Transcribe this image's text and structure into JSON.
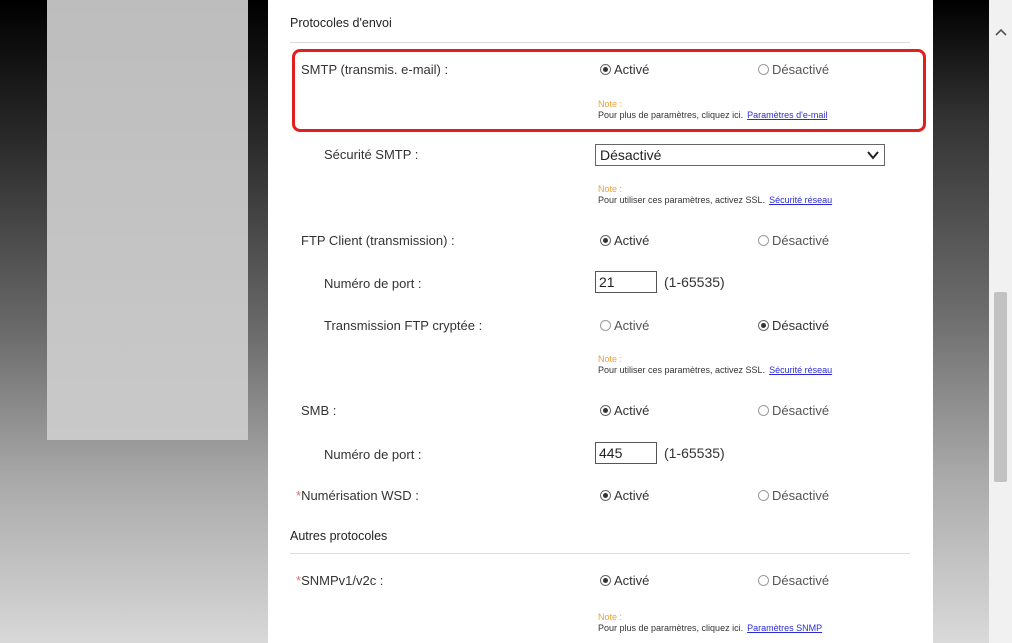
{
  "sections": {
    "send_title": "Protocoles d'envoi",
    "other_title": "Autres protocoles"
  },
  "options": {
    "on": "Activé",
    "off": "Désactivé"
  },
  "smtp": {
    "label": "SMTP (transmis. e-mail) :",
    "selected": "on",
    "note_title": "Note :",
    "note_text": "Pour plus de paramètres, cliquez ici.",
    "note_link": "Paramètres d'e-mail"
  },
  "smtp_security": {
    "label": "Sécurité SMTP :",
    "value": "Désactivé",
    "note_title": "Note :",
    "note_text": "Pour utiliser ces paramètres, activez SSL.",
    "note_link": "Sécurité réseau"
  },
  "ftp_client": {
    "label": "FTP Client (transmission) :",
    "selected": "on"
  },
  "ftp_port": {
    "label": "Numéro de port :",
    "value": "21",
    "range": "(1-65535)"
  },
  "ftp_encrypted": {
    "label": "Transmission FTP cryptée :",
    "selected": "off",
    "note_title": "Note :",
    "note_text": "Pour utiliser ces paramètres, activez SSL.",
    "note_link": "Sécurité réseau"
  },
  "smb": {
    "label": "SMB :",
    "selected": "on"
  },
  "smb_port": {
    "label": "Numéro de port :",
    "value": "445",
    "range": "(1-65535)"
  },
  "wsd": {
    "required_mark": "*",
    "label": "Numérisation WSD :",
    "selected": "on"
  },
  "snmp": {
    "required_mark": "*",
    "label": "SNMPv1/v2c :",
    "selected": "on",
    "note_title": "Note :",
    "note_text": "Pour plus de paramètres, cliquez ici.",
    "note_link": "Paramètres SNMP"
  },
  "scrollbar": {
    "up_icon": "chevron-up-icon"
  }
}
